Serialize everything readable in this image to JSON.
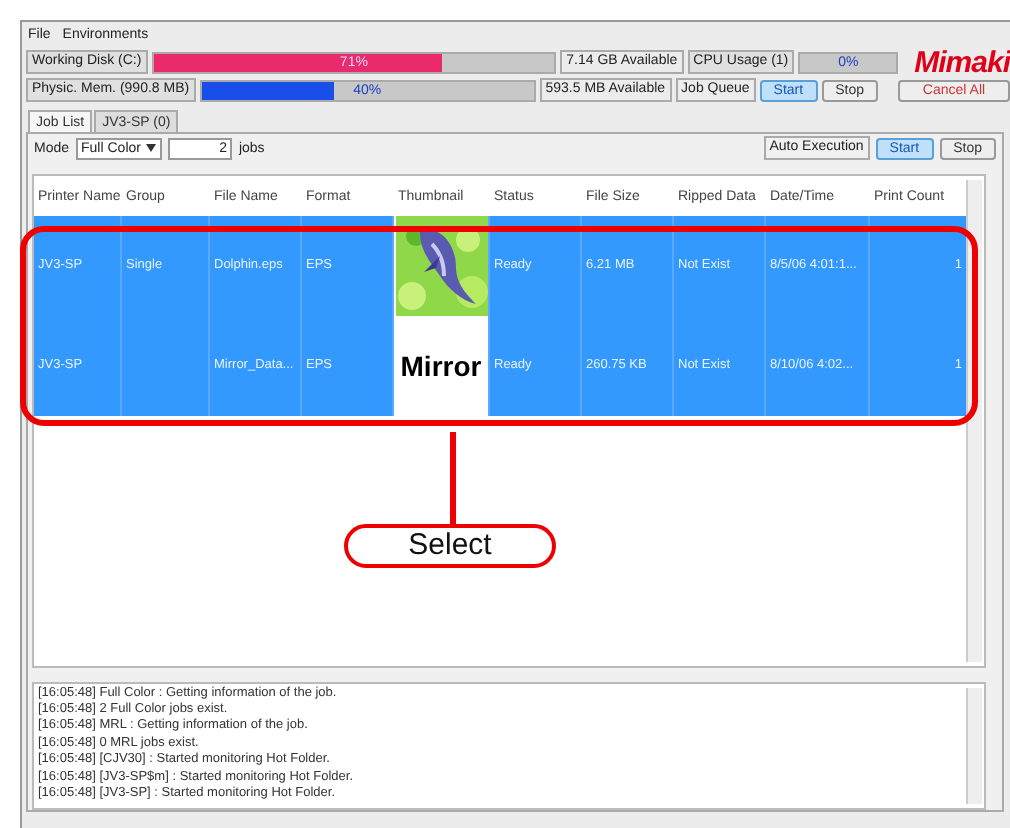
{
  "menu": [
    "File",
    "Environments"
  ],
  "status": {
    "disk": {
      "label": "Working Disk (C:)",
      "level": 0.72,
      "reading": "71%",
      "available": "7.14 GB Available"
    },
    "memory": {
      "label": "Physic. Mem. (990.8 MB)",
      "level": 0.4,
      "reading": "40%",
      "available": "593.5 MB Available"
    },
    "cpu": {
      "label": "CPU Usage (1)",
      "reading": "0%"
    },
    "queue": {
      "label": "Job Queue",
      "buttons": [
        {
          "label": "Start",
          "selected": true
        },
        {
          "label": "Stop",
          "selected": false
        }
      ]
    },
    "logo": "Mimaki",
    "cancel": "Cancel All"
  },
  "tabs": [
    {
      "label": "Job List",
      "selected": true
    },
    {
      "label": "JV3-SP (0)",
      "selected": false
    }
  ],
  "toolbar": {
    "mode_label": "Mode",
    "mode": "Full Color",
    "count": "2",
    "count_unit": "jobs",
    "auto_label": "Auto Execution",
    "buttons": [
      {
        "label": "Start",
        "selected": true
      },
      {
        "label": "Stop",
        "selected": false
      }
    ]
  },
  "table": {
    "columns": [
      "Printer Name",
      "Group",
      "File Name",
      "Format",
      "Thumbnail",
      "Status",
      "File Size",
      "Ripped Data",
      "Date/Time",
      "Print Count"
    ],
    "rows": [
      {
        "selected": true,
        "cells": [
          "JV3-SP",
          "Single",
          "Dolphin.eps",
          "EPS",
          null,
          "Ready",
          "6.21 MB",
          "Not Exist",
          "8/5/06 4:01:1...",
          "1"
        ]
      },
      {
        "selected": true,
        "cells": [
          "JV3-SP",
          "",
          "Mirror_Data...",
          "EPS",
          null,
          "Ready",
          "260.75 KB",
          "Not Exist",
          "8/10/06 4:02...",
          "1"
        ],
        "thumbnail": {
          "kind": "text",
          "text": "Mirror"
        }
      }
    ]
  },
  "log": [
    "[16:05:48] Full Color : Getting information of the job.",
    "[16:05:48] 2 Full Color jobs exist.",
    "[16:05:48] MRL : Getting information of the job.",
    "[16:05:48] 0 MRL jobs exist.",
    "[16:05:48] [CJV30] : Started monitoring Hot Folder.",
    "[16:05:48] [JV3-SP$m] : Started monitoring Hot Folder.",
    "[16:05:48] [JV3-SP] : Started monitoring Hot Folder."
  ],
  "callout": {
    "label": "Select"
  }
}
